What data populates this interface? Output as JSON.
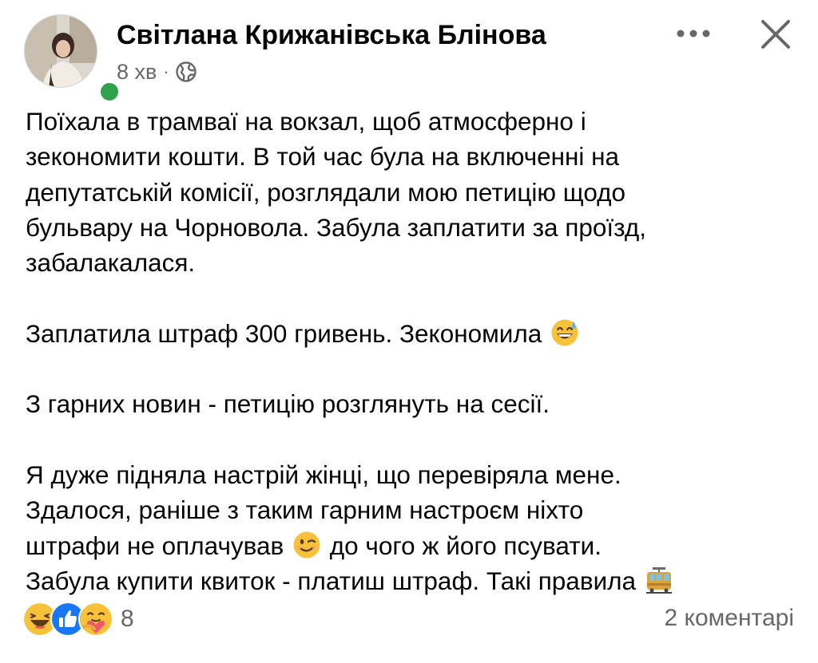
{
  "post": {
    "author": {
      "name": "Світлана Крижанівська Блінова",
      "avatar_icon": "user-avatar-photo",
      "online_status_color": "#31a24c"
    },
    "timestamp": "8 хв",
    "separator": "·",
    "privacy_icon": "globe-icon",
    "header_actions": {
      "more_icon": "more-dots-icon",
      "close_icon": "close-icon"
    },
    "body": {
      "p1": {
        "line1": "Поїхала в трамваї на вокзал, щоб атмосферно і",
        "line2": "зекономити кошти. В той час була на включенні на",
        "line3": "депутатській комісії, розглядали мою петицію щодо",
        "line4": "бульвару на Чорновола. Забула заплатити за проїзд,",
        "line5": "забалакалася."
      },
      "p2": {
        "text": "Заплатила штраф 300 гривень. Зекономила",
        "emoji": "grinning-sweat-emoji"
      },
      "p3": {
        "text": "З гарних новин - петицію розглянуть на сесії."
      },
      "p4": {
        "line1": "Я дуже підняла настрій жінці, що перевіряла мене.",
        "line2": "Здалося, раніше з таким гарним настроєм ніхто",
        "line3_before": "штрафи не оплачував",
        "line3_emoji": "wink-emoji",
        "line3_after": "до чого ж його псувати.",
        "line4": "Забула купити квиток - платиш штраф. Такі правила",
        "line4_emoji": "tram-emoji"
      }
    },
    "footer": {
      "reactions": [
        "haha-reaction-icon",
        "like-reaction-icon",
        "care-reaction-icon"
      ],
      "reaction_count": "8",
      "comments": "2 коментарі"
    },
    "colors": {
      "text": "#050505",
      "secondary_text": "#65676b",
      "like_blue": "#1877f2"
    }
  }
}
